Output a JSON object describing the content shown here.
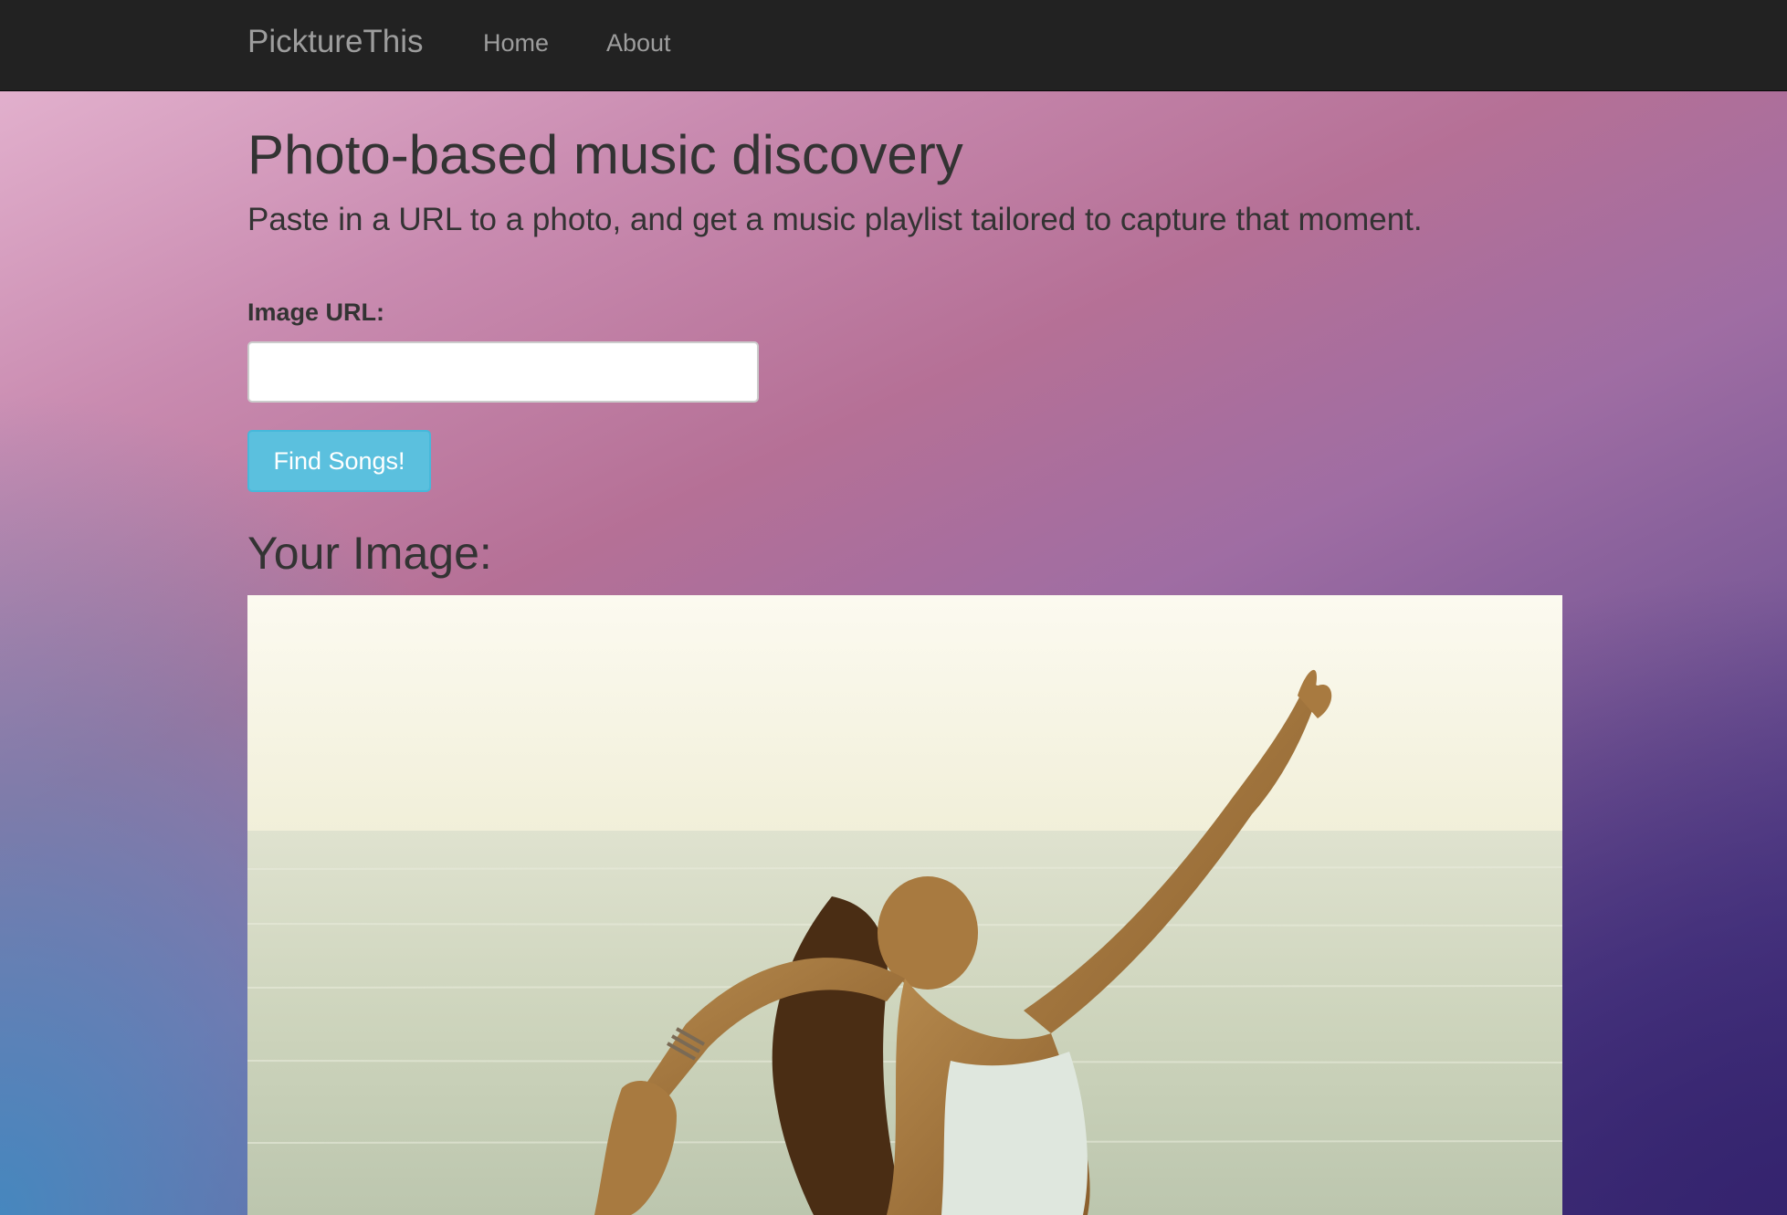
{
  "navbar": {
    "brand": "PicktureThis",
    "links": [
      {
        "label": "Home"
      },
      {
        "label": "About"
      }
    ]
  },
  "hero": {
    "title": "Photo-based music discovery",
    "subtitle": "Paste in a URL to a photo, and get a music playlist tailored to capture that moment."
  },
  "form": {
    "image_url_label": "Image URL:",
    "image_url_value": "",
    "submit_label": "Find Songs!"
  },
  "result": {
    "heading": "Your Image:",
    "image_description": "yoga-pose-by-the-sea-photo"
  },
  "colors": {
    "navbar": "#222222",
    "nav_text": "#9d9d9d",
    "button_info": "#5bc0de",
    "text": "#333333"
  }
}
